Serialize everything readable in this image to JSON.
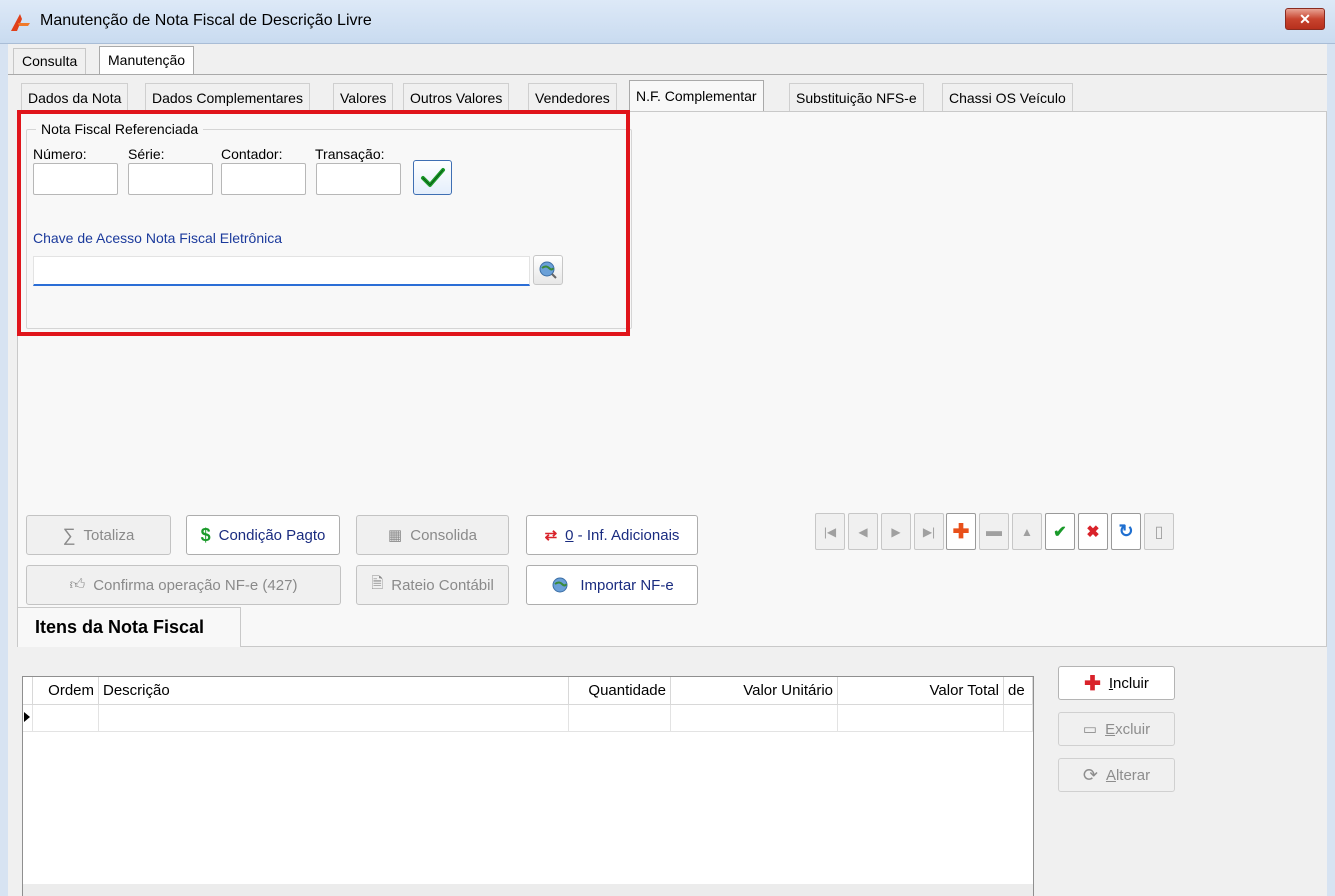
{
  "window": {
    "title": "Manutenção de Nota Fiscal de Descrição Livre",
    "close_glyph": "✕"
  },
  "top_tabs": [
    {
      "label": "Consulta",
      "active": false
    },
    {
      "label": "Manutenção",
      "active": true
    }
  ],
  "inner_tabs": [
    {
      "label": "Dados da Nota",
      "active": false
    },
    {
      "label": "Dados Complementares",
      "active": false
    },
    {
      "label": "Valores",
      "active": false
    },
    {
      "label": "Outros Valores",
      "active": false
    },
    {
      "label": "Vendedores",
      "active": false
    },
    {
      "label": "N.F. Complementar",
      "active": true
    },
    {
      "label": "Substituição NFS-e",
      "active": false
    },
    {
      "label": "Chassi OS Veículo",
      "active": false
    }
  ],
  "nf_referenciada": {
    "group_title": "Nota Fiscal Referenciada",
    "numero_label": "Número:",
    "serie_label": "Série:",
    "contador_label": "Contador:",
    "transacao_label": "Transação:",
    "numero_value": "",
    "serie_value": "",
    "contador_value": "",
    "transacao_value": "",
    "chave_label": "Chave de Acesso Nota Fiscal Eletrônica",
    "chave_value": ""
  },
  "actions": {
    "totaliza": "Totaliza",
    "condicao_pagto": "Condição Pagto",
    "consolida": "Consolida",
    "inf_adicionais_prefix": "0",
    "inf_adicionais_suffix": " - Inf. Adicionais",
    "confirma_nfe": "Confirma operação NF-e (427)",
    "rateio_contabil": "Rateio Contábil",
    "importar_nfe": "Importar NF-e"
  },
  "itens": {
    "tab_label": "Itens da Nota Fiscal",
    "columns": [
      "Ordem",
      "Descrição",
      "Quantidade",
      "Valor Unitário",
      "Valor Total",
      "de"
    ],
    "rows": [],
    "incluir_first": "I",
    "incluir_rest": "ncluir",
    "excluir_first": "E",
    "excluir_rest": "xcluir",
    "alterar_first": "A",
    "alterar_rest": "lterar"
  },
  "colors": {
    "highlight_border": "#e0151b",
    "link_blue": "#1b3a9c",
    "accent_green": "#1a9a2a",
    "accent_red": "#d9222a"
  }
}
